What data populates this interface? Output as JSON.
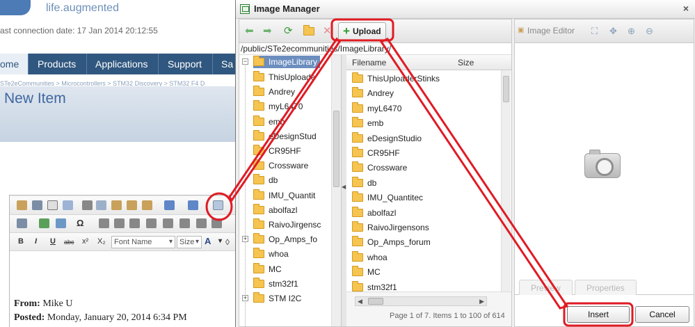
{
  "background_page": {
    "logo_text": "life.augmented",
    "last_connection": "ast connection date: 17 Jan 2014 20:12:55",
    "nav": [
      "ome",
      "Products",
      "Applications",
      "Support",
      "Sa"
    ],
    "breadcrumb": "STe2eCommunities > Microcontrollers > STM32 Discovery > STM32 F4 D",
    "page_heading": "New Item",
    "editor_toolbar": {
      "font_name": "Font Name",
      "size": "Size",
      "bold": "B",
      "italic": "I",
      "underline": "U",
      "strike": "abc",
      "superscript": "x²",
      "subscript": "X₂",
      "omega": "Ω"
    },
    "email_lines": [
      {
        "label": "From:",
        "value": "Mike U"
      },
      {
        "label": "Posted:",
        "value": "Monday, January 20, 2014 6:34 PM"
      }
    ]
  },
  "dialog": {
    "title": "Image Manager",
    "close": "×",
    "upload_label": "Upload",
    "path": "/public/STe2ecommunities/ImageLibrary/",
    "tree": {
      "root": "ImageLibrary",
      "items": [
        "ThisUploade",
        "Andrey",
        "myL6470",
        "emb",
        "eDesignStud",
        "CR95HF",
        "Crossware",
        "db",
        "IMU_Quantit",
        "abolfazl",
        "RaivoJirgensc",
        "Op_Amps_fo",
        "whoa",
        "MC",
        "stm32f1",
        "STM I2C"
      ]
    },
    "grid": {
      "col_filename": "Filename",
      "col_size": "Size",
      "rows": [
        "ThisUploaderStinks",
        "Andrey",
        "myL6470",
        "emb",
        "eDesignStudio",
        "CR95HF",
        "Crossware",
        "db",
        "IMU_Quantitec",
        "abolfazl",
        "RaivoJirgensons",
        "Op_Amps_forum",
        "whoa",
        "MC",
        "stm32f1"
      ]
    },
    "pager": {
      "text": "Page 1 of 7. Items 1 to 100 of 614"
    },
    "right": {
      "image_editor": "Image Editor",
      "tab_preview": "Preview",
      "tab_properties": "Properties"
    },
    "insert_label": "Insert",
    "cancel_label": "Cancel"
  },
  "colors": {
    "annotation": "#e01b24",
    "nav_bar": "#30577f",
    "selected_tree": "#6c8ebf"
  }
}
